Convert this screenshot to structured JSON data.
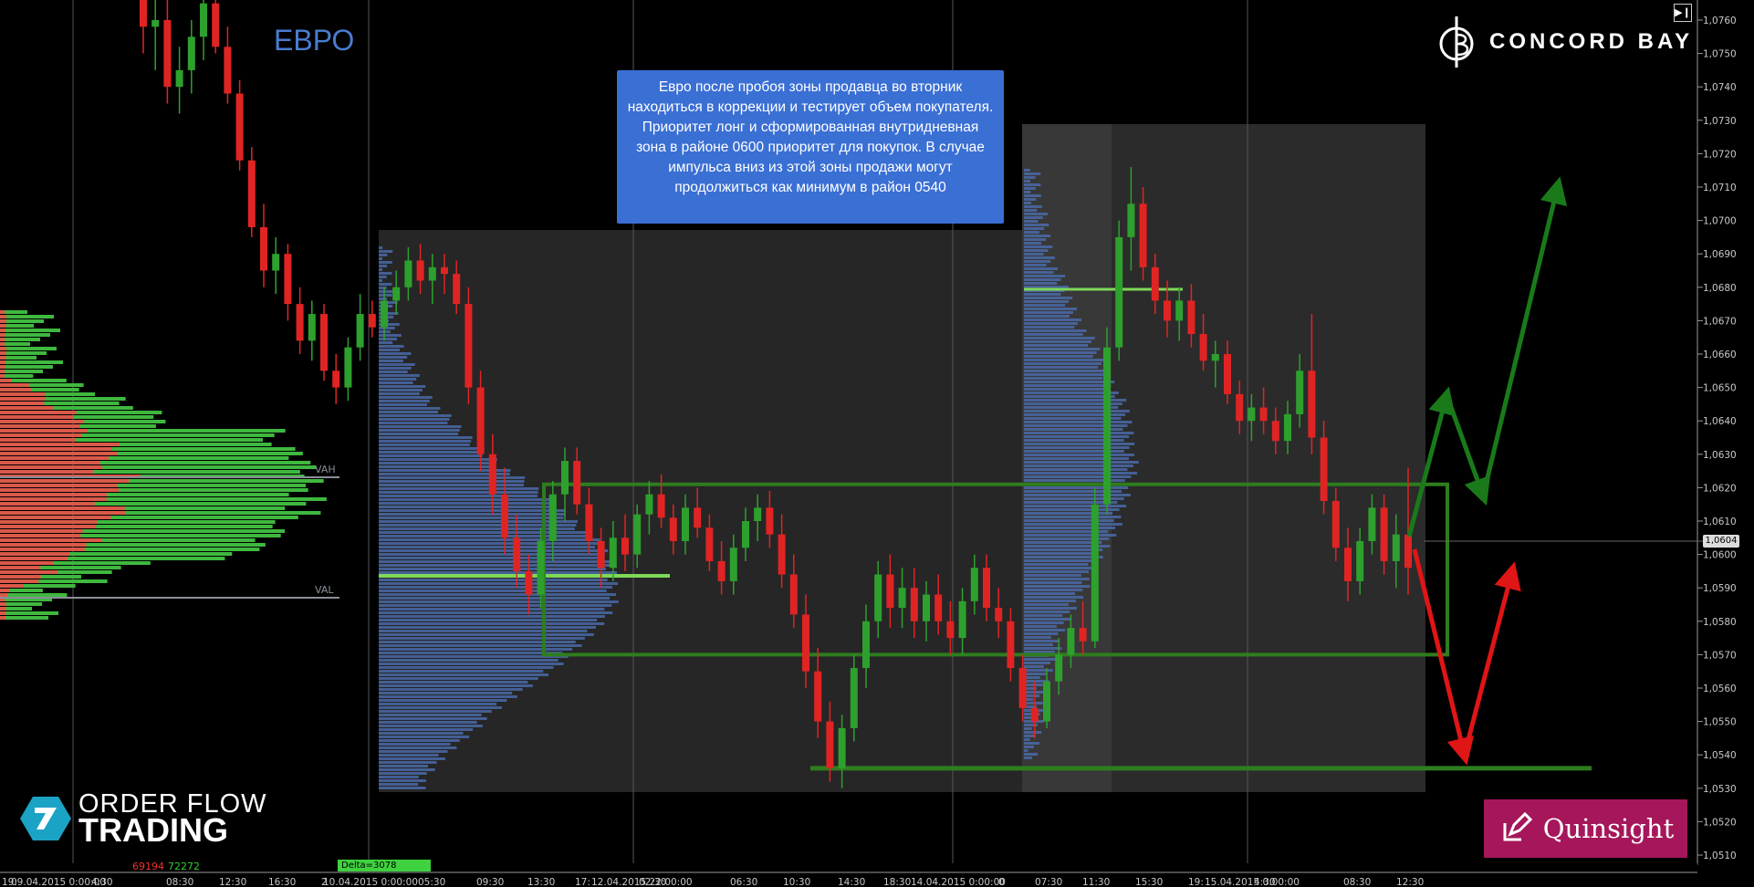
{
  "title": "ЕВРО",
  "note": "Евро после пробоя зоны продавца во вторник находиться в коррекции и тестирует объем покупателя. Приоритет лонг и сформированная внутридневная зона в районе 0600 приоритет для покупок. В случае импульса вниз из этой зоны продажи могут продолжиться как минимум в район 0540",
  "brands": {
    "top": "CONCORD BAY",
    "left_line1": "ORDER FLOW",
    "left_line2": "TRADING",
    "right": "Quinsight"
  },
  "colors": {
    "background": "#000000",
    "up_candle": "#2ea02e",
    "down_candle": "#e02424",
    "zone": "#2e7d1e",
    "level": "#7ed957",
    "profile_buy": "#3fb83f",
    "profile_sell": "#d9594a",
    "volume_profile": "#4a6aa8",
    "arrow_green": "#1a7a1a",
    "arrow_red": "#e01515",
    "note_bg": "#3a6fd4"
  },
  "chart_data": {
    "type": "candlestick",
    "instrument": "ЕВРО",
    "y_axis": {
      "ticks": [
        "1,0760",
        "1,0750",
        "1,0740",
        "1,0730",
        "1,0720",
        "1,0710",
        "1,0700",
        "1,0690",
        "1,0680",
        "1,0670",
        "1,0660",
        "1,0650",
        "1,0640",
        "1,0630",
        "1,0620",
        "1,0610",
        "1,0600",
        "1,0590",
        "1,0580",
        "1,0570",
        "1,0560",
        "1,0550",
        "1,0540",
        "1,0530",
        "1,0520",
        "1,0510"
      ],
      "range": [
        1.0505,
        1.0765
      ]
    },
    "current_price": "1,0604",
    "profile_labels": {
      "vah": "VAH",
      "val": "VAL"
    },
    "x_axis": {
      "ticks": [
        "19:",
        "09.04.2015 0:00:00",
        "4:30",
        "08:30",
        "12:30",
        "16:30",
        "2",
        "10.04.2015 0:00:00",
        "05:30",
        "09:30",
        "13:30",
        "17:",
        "12.04.2015 22:00:00",
        "02:30",
        "06:30",
        "10:30",
        "14:30",
        "18:30",
        "14.04.2015 0:00:00",
        "0",
        "07:30",
        "11:30",
        "15:30",
        "19:",
        "15.04.2015 0:00:00",
        "4:30",
        "08:30",
        "12:30"
      ]
    },
    "bottom_stats": {
      "sell": "69194",
      "buy": "72272",
      "delta": "Delta=3078"
    },
    "zones": [
      {
        "name": "buyer-zone",
        "from": 1.057,
        "to": 1.0621
      },
      {
        "name": "support-level",
        "value": 1.0536
      }
    ],
    "candles": [
      {
        "o": 1.0772,
        "h": 1.078,
        "l": 1.075,
        "c": 1.0758
      },
      {
        "o": 1.0758,
        "h": 1.0775,
        "l": 1.0745,
        "c": 1.076
      },
      {
        "o": 1.076,
        "h": 1.0768,
        "l": 1.0735,
        "c": 1.074
      },
      {
        "o": 1.074,
        "h": 1.0752,
        "l": 1.0732,
        "c": 1.0745
      },
      {
        "o": 1.0745,
        "h": 1.076,
        "l": 1.0738,
        "c": 1.0755
      },
      {
        "o": 1.0755,
        "h": 1.077,
        "l": 1.0748,
        "c": 1.0765
      },
      {
        "o": 1.0765,
        "h": 1.0775,
        "l": 1.075,
        "c": 1.0752
      },
      {
        "o": 1.0752,
        "h": 1.0758,
        "l": 1.0735,
        "c": 1.0738
      },
      {
        "o": 1.0738,
        "h": 1.0742,
        "l": 1.0715,
        "c": 1.0718
      },
      {
        "o": 1.0718,
        "h": 1.0722,
        "l": 1.0695,
        "c": 1.0698
      },
      {
        "o": 1.0698,
        "h": 1.0705,
        "l": 1.068,
        "c": 1.0685
      },
      {
        "o": 1.0685,
        "h": 1.0695,
        "l": 1.0678,
        "c": 1.069
      },
      {
        "o": 1.069,
        "h": 1.0693,
        "l": 1.067,
        "c": 1.0675
      },
      {
        "o": 1.0675,
        "h": 1.068,
        "l": 1.066,
        "c": 1.0664
      },
      {
        "o": 1.0664,
        "h": 1.0676,
        "l": 1.0658,
        "c": 1.0672
      },
      {
        "o": 1.0672,
        "h": 1.0675,
        "l": 1.0652,
        "c": 1.0655
      },
      {
        "o": 1.0655,
        "h": 1.066,
        "l": 1.0645,
        "c": 1.065
      },
      {
        "o": 1.065,
        "h": 1.0665,
        "l": 1.0646,
        "c": 1.0662
      },
      {
        "o": 1.0662,
        "h": 1.0678,
        "l": 1.0658,
        "c": 1.0672
      },
      {
        "o": 1.0672,
        "h": 1.0676,
        "l": 1.0665,
        "c": 1.0668
      },
      {
        "o": 1.0668,
        "h": 1.068,
        "l": 1.0664,
        "c": 1.0676
      },
      {
        "o": 1.0676,
        "h": 1.0685,
        "l": 1.0672,
        "c": 1.068
      },
      {
        "o": 1.068,
        "h": 1.0692,
        "l": 1.0676,
        "c": 1.0688
      },
      {
        "o": 1.0688,
        "h": 1.0693,
        "l": 1.0678,
        "c": 1.0682
      },
      {
        "o": 1.0682,
        "h": 1.069,
        "l": 1.0675,
        "c": 1.0686
      },
      {
        "o": 1.0686,
        "h": 1.069,
        "l": 1.0678,
        "c": 1.0684
      },
      {
        "o": 1.0684,
        "h": 1.0688,
        "l": 1.0672,
        "c": 1.0675
      },
      {
        "o": 1.0675,
        "h": 1.068,
        "l": 1.0645,
        "c": 1.065
      },
      {
        "o": 1.065,
        "h": 1.0655,
        "l": 1.0625,
        "c": 1.063
      },
      {
        "o": 1.063,
        "h": 1.0636,
        "l": 1.0612,
        "c": 1.0618
      },
      {
        "o": 1.0618,
        "h": 1.0626,
        "l": 1.06,
        "c": 1.0605
      },
      {
        "o": 1.0605,
        "h": 1.0612,
        "l": 1.059,
        "c": 1.0595
      },
      {
        "o": 1.0595,
        "h": 1.06,
        "l": 1.0582,
        "c": 1.0588
      },
      {
        "o": 1.0588,
        "h": 1.0608,
        "l": 1.0584,
        "c": 1.0604
      },
      {
        "o": 1.0604,
        "h": 1.0622,
        "l": 1.0598,
        "c": 1.0618
      },
      {
        "o": 1.0618,
        "h": 1.0632,
        "l": 1.061,
        "c": 1.0628
      },
      {
        "o": 1.0628,
        "h": 1.0632,
        "l": 1.0612,
        "c": 1.0615
      },
      {
        "o": 1.0615,
        "h": 1.062,
        "l": 1.06,
        "c": 1.0604
      },
      {
        "o": 1.0604,
        "h": 1.0608,
        "l": 1.059,
        "c": 1.0596
      },
      {
        "o": 1.0596,
        "h": 1.061,
        "l": 1.0592,
        "c": 1.0605
      },
      {
        "o": 1.0605,
        "h": 1.0612,
        "l": 1.0595,
        "c": 1.06
      },
      {
        "o": 1.06,
        "h": 1.0615,
        "l": 1.0596,
        "c": 1.0612
      },
      {
        "o": 1.0612,
        "h": 1.0622,
        "l": 1.0606,
        "c": 1.0618
      },
      {
        "o": 1.0618,
        "h": 1.0624,
        "l": 1.0608,
        "c": 1.0611
      },
      {
        "o": 1.0611,
        "h": 1.0615,
        "l": 1.06,
        "c": 1.0604
      },
      {
        "o": 1.0604,
        "h": 1.0618,
        "l": 1.06,
        "c": 1.0614
      },
      {
        "o": 1.0614,
        "h": 1.062,
        "l": 1.0605,
        "c": 1.0608
      },
      {
        "o": 1.0608,
        "h": 1.0612,
        "l": 1.0595,
        "c": 1.0598
      },
      {
        "o": 1.0598,
        "h": 1.0604,
        "l": 1.0588,
        "c": 1.0592
      },
      {
        "o": 1.0592,
        "h": 1.0606,
        "l": 1.0588,
        "c": 1.0602
      },
      {
        "o": 1.0602,
        "h": 1.0614,
        "l": 1.0598,
        "c": 1.061
      },
      {
        "o": 1.061,
        "h": 1.0618,
        "l": 1.0604,
        "c": 1.0614
      },
      {
        "o": 1.0614,
        "h": 1.0619,
        "l": 1.0602,
        "c": 1.0606
      },
      {
        "o": 1.0606,
        "h": 1.0612,
        "l": 1.059,
        "c": 1.0594
      },
      {
        "o": 1.0594,
        "h": 1.06,
        "l": 1.0578,
        "c": 1.0582
      },
      {
        "o": 1.0582,
        "h": 1.0588,
        "l": 1.056,
        "c": 1.0565
      },
      {
        "o": 1.0565,
        "h": 1.0572,
        "l": 1.0545,
        "c": 1.055
      },
      {
        "o": 1.055,
        "h": 1.0556,
        "l": 1.0532,
        "c": 1.0536
      },
      {
        "o": 1.0536,
        "h": 1.0552,
        "l": 1.053,
        "c": 1.0548
      },
      {
        "o": 1.0548,
        "h": 1.057,
        "l": 1.0544,
        "c": 1.0566
      },
      {
        "o": 1.0566,
        "h": 1.0585,
        "l": 1.056,
        "c": 1.058
      },
      {
        "o": 1.058,
        "h": 1.0598,
        "l": 1.0575,
        "c": 1.0594
      },
      {
        "o": 1.0594,
        "h": 1.06,
        "l": 1.0578,
        "c": 1.0584
      },
      {
        "o": 1.0584,
        "h": 1.0596,
        "l": 1.0578,
        "c": 1.059
      },
      {
        "o": 1.059,
        "h": 1.0596,
        "l": 1.0575,
        "c": 1.058
      },
      {
        "o": 1.058,
        "h": 1.0592,
        "l": 1.0574,
        "c": 1.0588
      },
      {
        "o": 1.0588,
        "h": 1.0594,
        "l": 1.0576,
        "c": 1.058
      },
      {
        "o": 1.058,
        "h": 1.0586,
        "l": 1.057,
        "c": 1.0575
      },
      {
        "o": 1.0575,
        "h": 1.059,
        "l": 1.057,
        "c": 1.0586
      },
      {
        "o": 1.0586,
        "h": 1.06,
        "l": 1.0582,
        "c": 1.0596
      },
      {
        "o": 1.0596,
        "h": 1.06,
        "l": 1.058,
        "c": 1.0584
      },
      {
        "o": 1.0584,
        "h": 1.059,
        "l": 1.0575,
        "c": 1.058
      },
      {
        "o": 1.058,
        "h": 1.0584,
        "l": 1.0562,
        "c": 1.0566
      },
      {
        "o": 1.0566,
        "h": 1.057,
        "l": 1.055,
        "c": 1.0554
      },
      {
        "o": 1.0554,
        "h": 1.0562,
        "l": 1.0545,
        "c": 1.055
      },
      {
        "o": 1.055,
        "h": 1.0566,
        "l": 1.0548,
        "c": 1.0562
      },
      {
        "o": 1.0562,
        "h": 1.0575,
        "l": 1.0558,
        "c": 1.057
      },
      {
        "o": 1.057,
        "h": 1.0582,
        "l": 1.0566,
        "c": 1.0578
      },
      {
        "o": 1.0578,
        "h": 1.0586,
        "l": 1.057,
        "c": 1.0574
      },
      {
        "o": 1.0574,
        "h": 1.062,
        "l": 1.0572,
        "c": 1.0615
      },
      {
        "o": 1.0615,
        "h": 1.0668,
        "l": 1.0612,
        "c": 1.0662
      },
      {
        "o": 1.0662,
        "h": 1.07,
        "l": 1.0658,
        "c": 1.0695
      },
      {
        "o": 1.0695,
        "h": 1.0716,
        "l": 1.0685,
        "c": 1.0705
      },
      {
        "o": 1.0705,
        "h": 1.071,
        "l": 1.0682,
        "c": 1.0686
      },
      {
        "o": 1.0686,
        "h": 1.069,
        "l": 1.0672,
        "c": 1.0676
      },
      {
        "o": 1.0676,
        "h": 1.0682,
        "l": 1.0665,
        "c": 1.067
      },
      {
        "o": 1.067,
        "h": 1.068,
        "l": 1.0664,
        "c": 1.0676
      },
      {
        "o": 1.0676,
        "h": 1.0681,
        "l": 1.0662,
        "c": 1.0666
      },
      {
        "o": 1.0666,
        "h": 1.0672,
        "l": 1.0655,
        "c": 1.0658
      },
      {
        "o": 1.0658,
        "h": 1.0664,
        "l": 1.065,
        "c": 1.066
      },
      {
        "o": 1.066,
        "h": 1.0664,
        "l": 1.0645,
        "c": 1.0648
      },
      {
        "o": 1.0648,
        "h": 1.0652,
        "l": 1.0636,
        "c": 1.064
      },
      {
        "o": 1.064,
        "h": 1.0648,
        "l": 1.0634,
        "c": 1.0644
      },
      {
        "o": 1.0644,
        "h": 1.065,
        "l": 1.0636,
        "c": 1.064
      },
      {
        "o": 1.064,
        "h": 1.0644,
        "l": 1.063,
        "c": 1.0634
      },
      {
        "o": 1.0634,
        "h": 1.0646,
        "l": 1.063,
        "c": 1.0642
      },
      {
        "o": 1.0642,
        "h": 1.066,
        "l": 1.0638,
        "c": 1.0655
      },
      {
        "o": 1.0655,
        "h": 1.0672,
        "l": 1.063,
        "c": 1.0635
      },
      {
        "o": 1.0635,
        "h": 1.064,
        "l": 1.0612,
        "c": 1.0616
      },
      {
        "o": 1.0616,
        "h": 1.062,
        "l": 1.0598,
        "c": 1.0602
      },
      {
        "o": 1.0602,
        "h": 1.0608,
        "l": 1.0586,
        "c": 1.0592
      },
      {
        "o": 1.0592,
        "h": 1.0608,
        "l": 1.0588,
        "c": 1.0604
      },
      {
        "o": 1.0604,
        "h": 1.0618,
        "l": 1.06,
        "c": 1.0614
      },
      {
        "o": 1.0614,
        "h": 1.0618,
        "l": 1.0594,
        "c": 1.0598
      },
      {
        "o": 1.0598,
        "h": 1.0612,
        "l": 1.059,
        "c": 1.0606
      },
      {
        "o": 1.0606,
        "h": 1.0626,
        "l": 1.0588,
        "c": 1.0596
      }
    ]
  }
}
